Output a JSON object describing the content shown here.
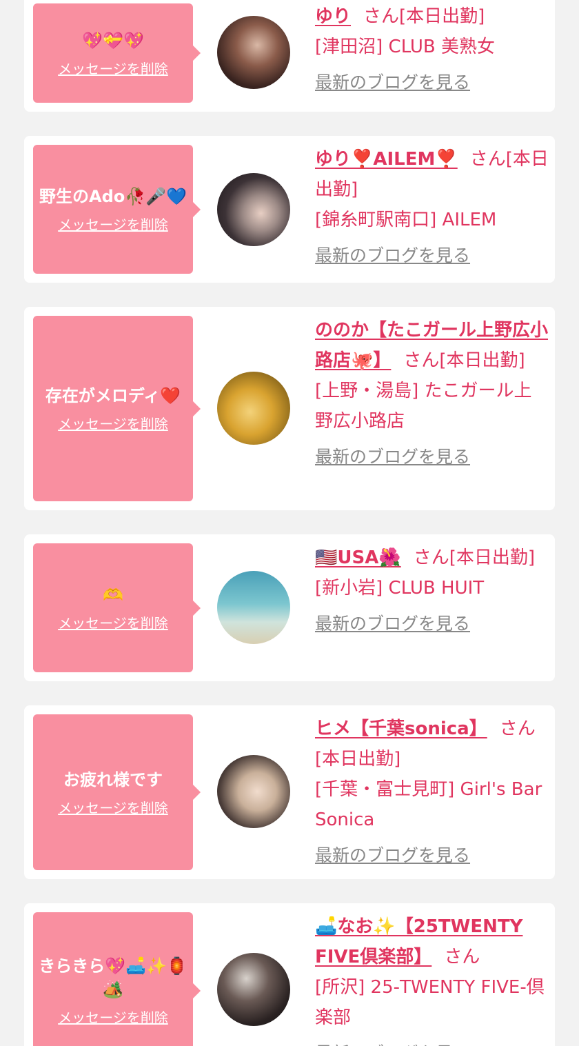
{
  "entries": [
    {
      "message": "💖💝💖",
      "delete_label": "メッセージを削除",
      "name": "ゆり",
      "suffix": "さん[本日出勤]",
      "shop": "[津田沼] CLUB 美熟女",
      "blog_label": "最新のブログを見る"
    },
    {
      "message": "野生のAdo🥀🎤💙",
      "delete_label": "メッセージを削除",
      "name": "ゆり❣️AILEM❣️",
      "suffix": "さん[本日出勤]",
      "shop": "[錦糸町駅南口] AILEM",
      "blog_label": "最新のブログを見る"
    },
    {
      "message": "存在がメロディ❤️",
      "delete_label": "メッセージを削除",
      "name": "ののか【たこガール上野広小路店🐙】",
      "suffix": "さん[本日出勤]",
      "shop": "[上野・湯島] たこガール上野広小路店",
      "blog_label": "最新のブログを見る"
    },
    {
      "message": "🫶",
      "delete_label": "メッセージを削除",
      "name": "🇺🇸USA🌺",
      "suffix": "さん[本日出勤]",
      "shop": "[新小岩] CLUB HUIT",
      "blog_label": "最新のブログを見る"
    },
    {
      "message": "お疲れ様です",
      "delete_label": "メッセージを削除",
      "name": "ヒメ【千葉sonica】",
      "suffix": "さん[本日出勤]",
      "shop": "[千葉・富士見町] Girl's Bar Sonica",
      "blog_label": "最新のブログを見る"
    },
    {
      "message": "きらきら💖🛋️✨🏮🏕️",
      "delete_label": "メッセージを削除",
      "name": "🛋️なお✨【25TWENTY FIVE倶楽部】",
      "suffix": "さん",
      "shop": "[所沢] 25-TWENTY FIVE-倶楽部",
      "blog_label": "最新のブログを見る"
    }
  ]
}
